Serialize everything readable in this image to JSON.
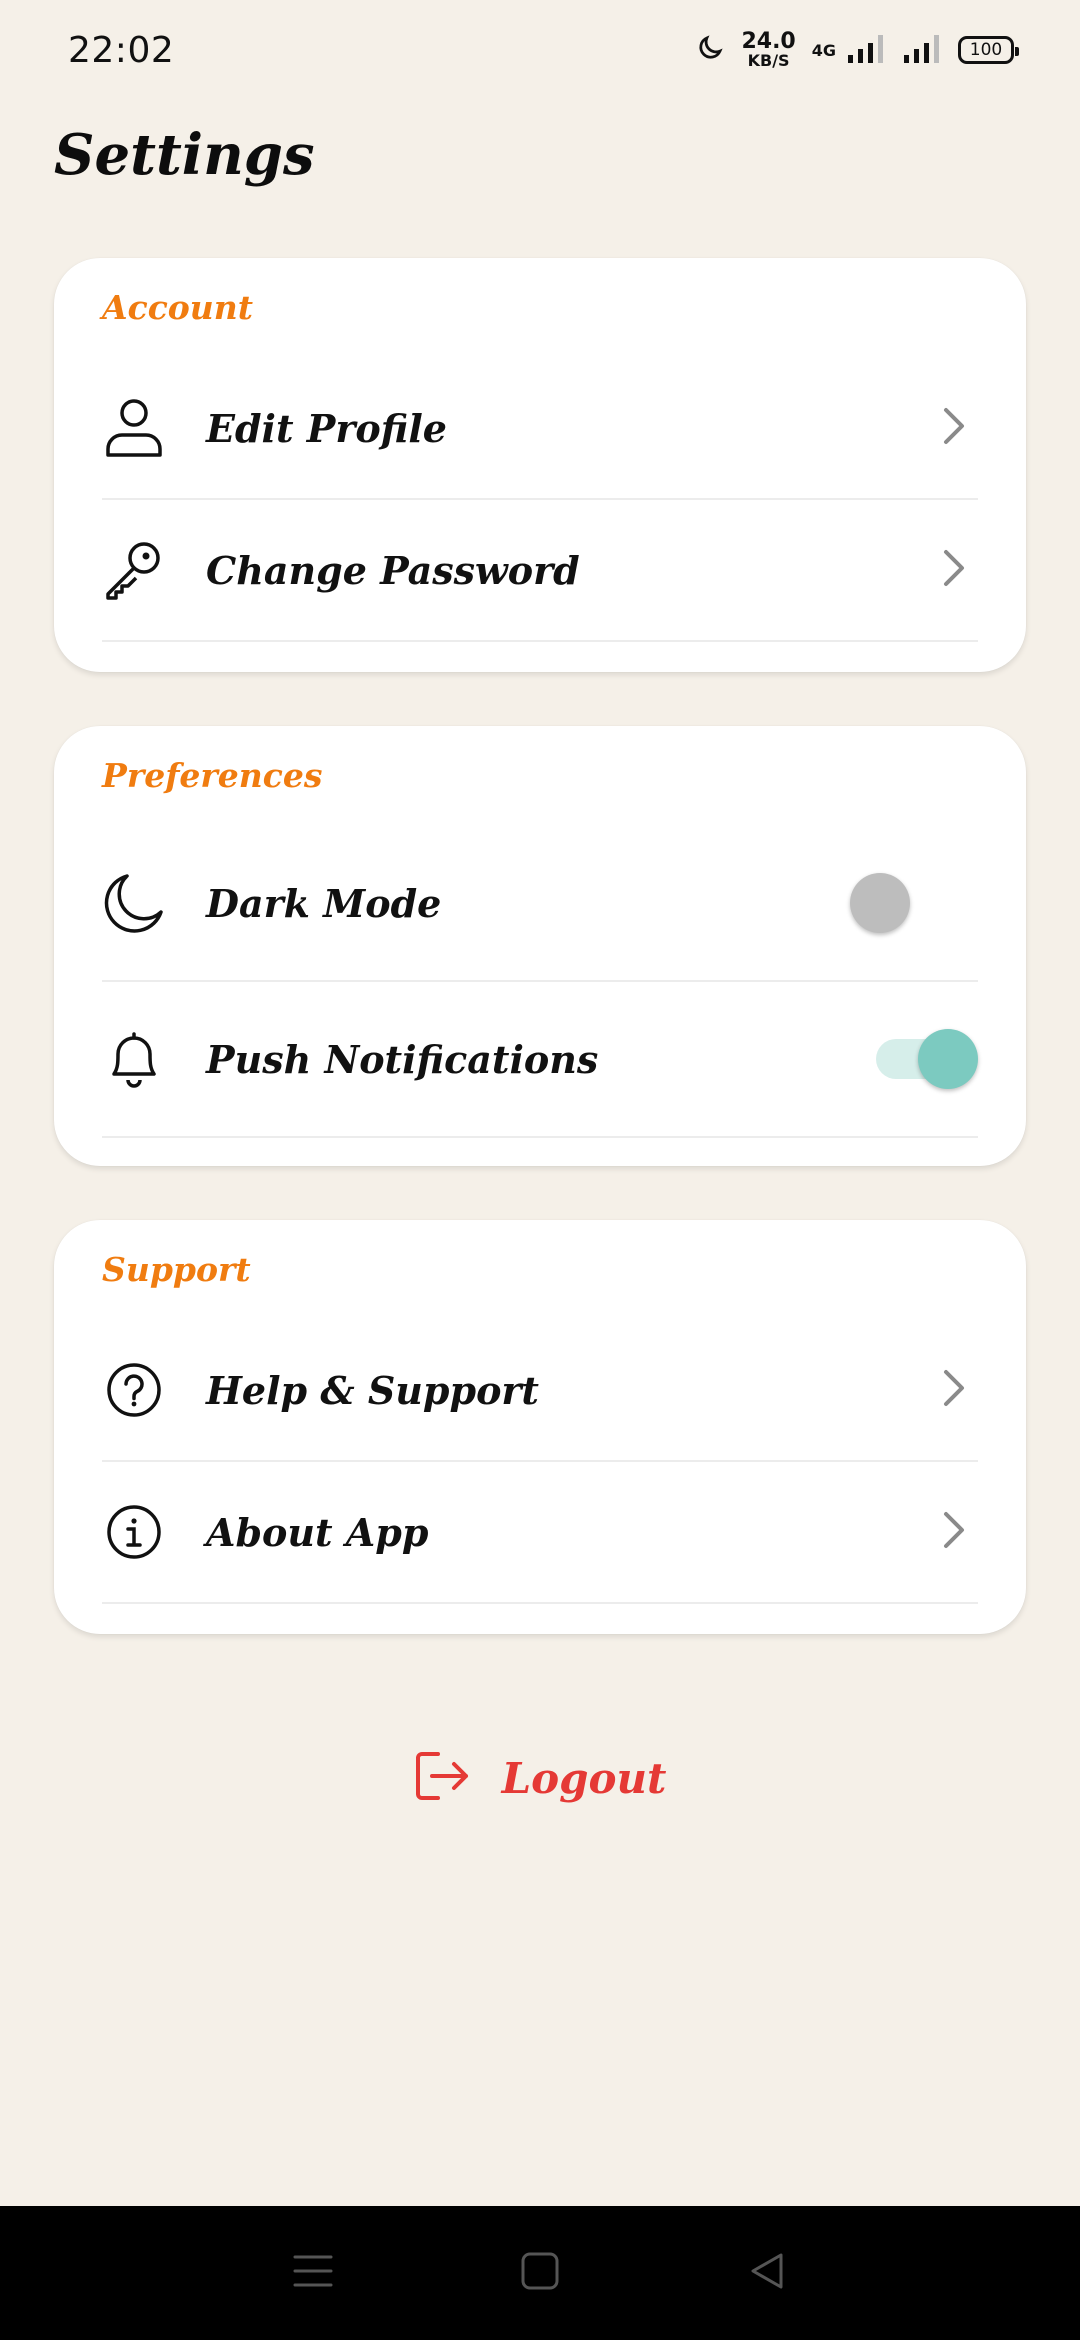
{
  "status_bar": {
    "time": "22:02",
    "net_speed_value": "24.0",
    "net_speed_unit": "KB/S",
    "network_type": "4G",
    "battery": "100",
    "icons": [
      "moon-icon",
      "signal-icon",
      "signal-icon-2",
      "battery-icon"
    ]
  },
  "page": {
    "title": "Settings"
  },
  "sections": {
    "account": {
      "title": "Account",
      "items": [
        {
          "label": "Edit Profile",
          "icon": "user-icon"
        },
        {
          "label": "Change Password",
          "icon": "key-icon"
        }
      ]
    },
    "preferences": {
      "title": "Preferences",
      "items": [
        {
          "label": "Dark Mode",
          "icon": "moon-icon",
          "toggle": false
        },
        {
          "label": "Push Notifications",
          "icon": "bell-icon",
          "toggle": true
        }
      ]
    },
    "support": {
      "title": "Support",
      "items": [
        {
          "label": "Help & Support",
          "icon": "question-circle-icon"
        },
        {
          "label": "About App",
          "icon": "info-circle-icon"
        }
      ]
    }
  },
  "logout": {
    "label": "Logout",
    "icon": "logout-icon"
  },
  "nav": {
    "icons": [
      "menu-icon",
      "home-icon",
      "back-icon"
    ]
  },
  "colors": {
    "background": "#F5F0E8",
    "section_title": "#F07C10",
    "logout": "#E53935",
    "toggle_on": "#7CCAC0",
    "toggle_off": "#BDBDBD"
  }
}
